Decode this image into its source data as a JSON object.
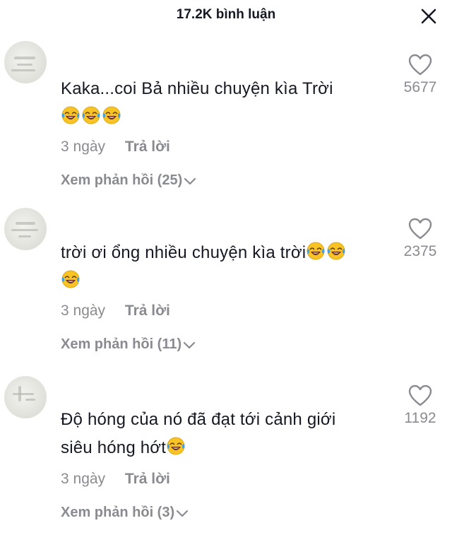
{
  "header": {
    "title": "17.2K bình luận"
  },
  "comments": [
    {
      "text": "Kaka...coi Bả nhiều chuyện kìa Trời",
      "emojis_line1": 0,
      "emojis_line2": 3,
      "time": "3 ngày",
      "reply_label": "Trả lời",
      "view_replies": "Xem phản hồi (25)",
      "likes": "5677"
    },
    {
      "text": "trời ơi ổng nhiều chuyện kìa trời",
      "emojis_line1": 2,
      "emojis_line2": 1,
      "time": "3 ngày",
      "reply_label": "Trả lời",
      "view_replies": "Xem phản hồi (11)",
      "likes": "2375"
    },
    {
      "text_line1": "Độ hóng của nó đã đạt tới cảnh giới",
      "text_line2": "siêu hóng hớt",
      "emojis_line2": 1,
      "time": "3 ngày",
      "reply_label": "Trả lời",
      "view_replies": "Xem phản hồi (3)",
      "likes": "1192"
    }
  ],
  "icons": {
    "close": "close-icon",
    "like": "heart-outline-icon",
    "emoji": "laughing-tears-emoji",
    "expand": "chevron-down-icon"
  },
  "colors": {
    "text": "#161823",
    "muted": "#8a8b91",
    "emoji_face": "#f7c325",
    "emoji_tears": "#3ea0e8"
  }
}
